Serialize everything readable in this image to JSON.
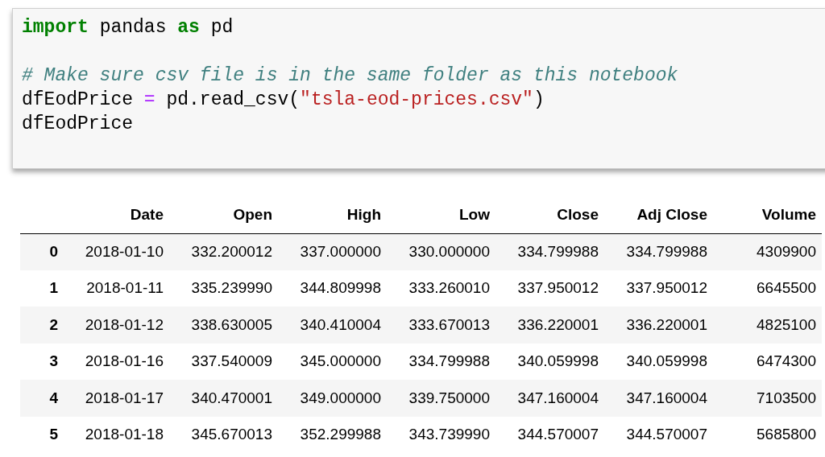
{
  "code_cell": {
    "blocks": [
      [
        [
          {
            "kind": "keyword",
            "text": "import"
          },
          {
            "kind": "plain",
            "text": " pandas "
          },
          {
            "kind": "keyword",
            "text": "as"
          },
          {
            "kind": "plain",
            "text": " pd"
          }
        ]
      ],
      [
        [
          {
            "kind": "comment",
            "text": "# Make sure csv file is in the same folder as this notebook"
          }
        ],
        [
          {
            "kind": "plain",
            "text": "dfEodPrice "
          },
          {
            "kind": "operator",
            "text": "="
          },
          {
            "kind": "plain",
            "text": " pd.read_csv("
          },
          {
            "kind": "string",
            "text": "\"tsla-eod-prices.csv\""
          },
          {
            "kind": "plain",
            "text": ")"
          }
        ],
        [
          {
            "kind": "plain",
            "text": "dfEodPrice"
          }
        ]
      ]
    ]
  },
  "table": {
    "columns": [
      "Date",
      "Open",
      "High",
      "Low",
      "Close",
      "Adj Close",
      "Volume"
    ],
    "rows": [
      {
        "index": "0",
        "cells": [
          "2018-01-10",
          "332.200012",
          "337.000000",
          "330.000000",
          "334.799988",
          "334.799988",
          "4309900"
        ]
      },
      {
        "index": "1",
        "cells": [
          "2018-01-11",
          "335.239990",
          "344.809998",
          "333.260010",
          "337.950012",
          "337.950012",
          "6645500"
        ]
      },
      {
        "index": "2",
        "cells": [
          "2018-01-12",
          "338.630005",
          "340.410004",
          "333.670013",
          "336.220001",
          "336.220001",
          "4825100"
        ]
      },
      {
        "index": "3",
        "cells": [
          "2018-01-16",
          "337.540009",
          "345.000000",
          "334.799988",
          "340.059998",
          "340.059998",
          "6474300"
        ]
      },
      {
        "index": "4",
        "cells": [
          "2018-01-17",
          "340.470001",
          "349.000000",
          "339.750000",
          "347.160004",
          "347.160004",
          "7103500"
        ]
      },
      {
        "index": "5",
        "cells": [
          "2018-01-18",
          "345.670013",
          "352.299988",
          "343.739990",
          "344.570007",
          "344.570007",
          "5685800"
        ]
      }
    ]
  }
}
